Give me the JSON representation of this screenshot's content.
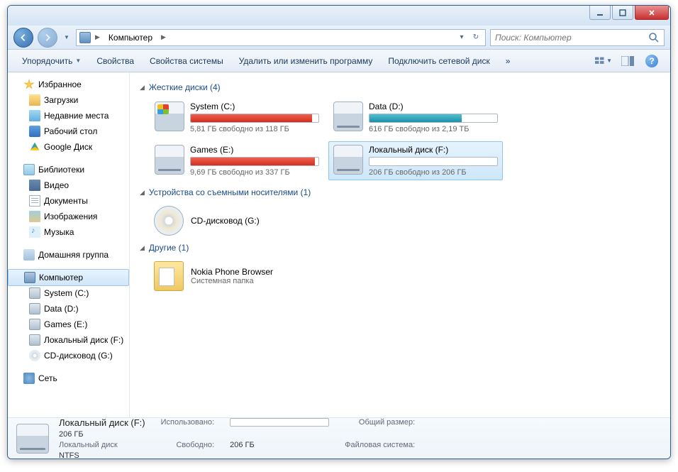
{
  "breadcrumb": {
    "location": "Компьютер"
  },
  "search": {
    "placeholder": "Поиск: Компьютер"
  },
  "toolbar": {
    "organize": "Упорядочить",
    "properties": "Свойства",
    "sys_properties": "Свойства системы",
    "uninstall": "Удалить или изменить программу",
    "map_drive": "Подключить сетевой диск",
    "more": "»"
  },
  "sidebar": {
    "favorites": {
      "label": "Избранное",
      "items": [
        "Загрузки",
        "Недавние места",
        "Рабочий стол",
        "Google Диск"
      ]
    },
    "libraries": {
      "label": "Библиотеки",
      "items": [
        "Видео",
        "Документы",
        "Изображения",
        "Музыка"
      ]
    },
    "homegroup": {
      "label": "Домашняя группа"
    },
    "computer": {
      "label": "Компьютер",
      "items": [
        "System (C:)",
        "Data (D:)",
        "Games (E:)",
        "Локальный диск (F:)",
        "CD-дисковод (G:)"
      ]
    },
    "network": {
      "label": "Сеть"
    }
  },
  "sections": {
    "hdd": "Жесткие диски (4)",
    "removable": "Устройства со съемными носителями (1)",
    "other": "Другие (1)"
  },
  "drives": [
    {
      "name": "System (C:)",
      "free": "5,81 ГБ свободно из 118 ГБ",
      "fill": 95,
      "color": "red",
      "icon": "win"
    },
    {
      "name": "Data (D:)",
      "free": "616 ГБ свободно из 2,19 ТБ",
      "fill": 72,
      "color": "teal",
      "icon": "hdd"
    },
    {
      "name": "Games (E:)",
      "free": "9,69 ГБ свободно из 337 ГБ",
      "fill": 97,
      "color": "red",
      "icon": "hdd"
    },
    {
      "name": "Локальный диск (F:)",
      "free": "206 ГБ свободно из 206 ГБ",
      "fill": 0,
      "color": "none",
      "icon": "hdd",
      "selected": true
    }
  ],
  "removable": {
    "name": "CD-дисковод (G:)"
  },
  "other": {
    "name": "Nokia Phone Browser",
    "sub": "Системная папка"
  },
  "details": {
    "title": "Локальный диск (F:)",
    "type": "Локальный диск",
    "used_label": "Использовано:",
    "free_label": "Свободно:",
    "free_val": "206 ГБ",
    "total_label": "Общий размер:",
    "total_val": "206 ГБ",
    "fs_label": "Файловая система:",
    "fs_val": "NTFS"
  }
}
